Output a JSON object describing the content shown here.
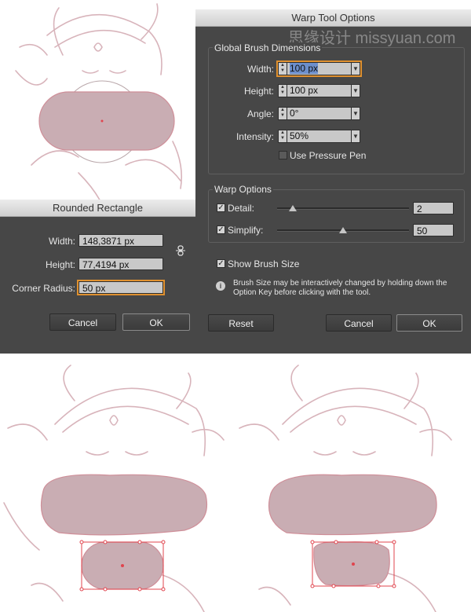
{
  "warp_dialog": {
    "title": "Warp Tool Options",
    "watermark": "思缘设计 missyuan.com",
    "global_group": "Global Brush Dimensions",
    "width_label": "Width:",
    "width_value": "100 px",
    "height_label": "Height:",
    "height_value": "100 px",
    "angle_label": "Angle:",
    "angle_value": "0°",
    "intensity_label": "Intensity:",
    "intensity_value": "50%",
    "pressure_label": "Use Pressure Pen",
    "warp_group": "Warp Options",
    "detail_label": "Detail:",
    "detail_value": "2",
    "detail_fraction": 0.12,
    "simplify_label": "Simplify:",
    "simplify_value": "50",
    "simplify_fraction": 0.5,
    "show_brush_label": "Show Brush Size",
    "info_text_line1": "Brush Size may be interactively changed by holding down the",
    "info_text_line2": "Option Key before clicking with the tool.",
    "reset_label": "Reset",
    "cancel_label": "Cancel",
    "ok_label": "OK"
  },
  "rect_dialog": {
    "title": "Rounded Rectangle",
    "width_label": "Width:",
    "width_value": "148,3871 px",
    "height_label": "Height:",
    "height_value": "77,4194 px",
    "radius_label": "Corner Radius:",
    "radius_value": "50 px",
    "cancel_label": "Cancel",
    "ok_label": "OK"
  },
  "icons": {
    "link": "chain-link-icon",
    "info": "info-icon",
    "spin": "spinner-arrows-icon",
    "dropdown": "chevron-down-icon"
  },
  "colors": {
    "dialog_bg": "#474747",
    "field_bg": "#c8c8c8",
    "focus": "#e0912f",
    "sketch": "#d8b4bb",
    "shape_fill": "#c9adb3",
    "selection": "#e0444e"
  }
}
